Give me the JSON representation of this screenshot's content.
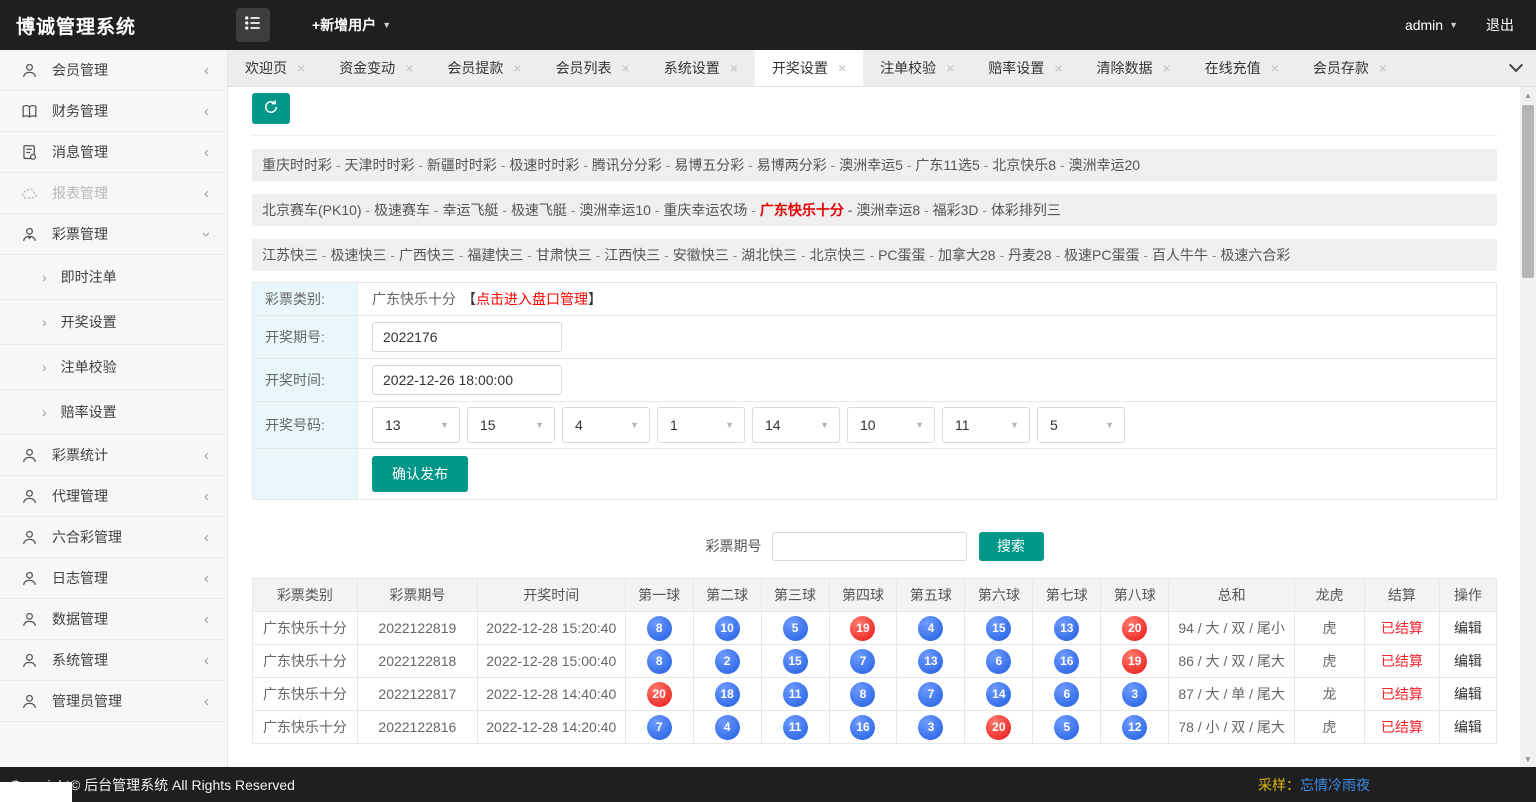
{
  "topbar": {
    "title": "博诚管理系统",
    "add_user": "+新增用户",
    "username": "admin",
    "logout": "退出"
  },
  "icons": {
    "close": "×",
    "caret_down": "▼",
    "chevron_left": "‹",
    "chevron_right": "›",
    "scroll_up": "▲",
    "scroll_down": "▼"
  },
  "tabs": [
    {
      "label": "欢迎页"
    },
    {
      "label": "资金变动"
    },
    {
      "label": "会员提款"
    },
    {
      "label": "会员列表"
    },
    {
      "label": "系统设置"
    },
    {
      "label": "开奖设置",
      "active": "true"
    },
    {
      "label": "注单校验"
    },
    {
      "label": "赔率设置"
    },
    {
      "label": "清除数据"
    },
    {
      "label": "在线充值"
    },
    {
      "label": "会员存款"
    }
  ],
  "sidebar": {
    "items": [
      {
        "label": "会员管理"
      },
      {
        "label": "财务管理"
      },
      {
        "label": "消息管理"
      },
      {
        "label": "报表管理"
      },
      {
        "label": "彩票管理",
        "expanded": "true",
        "children": [
          {
            "label": "即时注单"
          },
          {
            "label": "开奖设置"
          },
          {
            "label": "注单校验"
          },
          {
            "label": "赔率设置"
          }
        ]
      },
      {
        "label": "彩票统计"
      },
      {
        "label": "代理管理"
      },
      {
        "label": "六合彩管理"
      },
      {
        "label": "日志管理"
      },
      {
        "label": "数据管理"
      },
      {
        "label": "系统管理"
      },
      {
        "label": "管理员管理"
      }
    ]
  },
  "content": {
    "lottery_groups": [
      {
        "items": [
          {
            "label": "重庆时时彩"
          },
          {
            "label": "天津时时彩"
          },
          {
            "label": "新疆时时彩"
          },
          {
            "label": "极速时时彩"
          },
          {
            "label": "腾讯分分彩"
          },
          {
            "label": "易博五分彩"
          },
          {
            "label": "易博两分彩"
          },
          {
            "label": "澳洲幸运5"
          },
          {
            "label": "广东11选5"
          },
          {
            "label": "北京快乐8"
          },
          {
            "label": "澳洲幸运20"
          }
        ]
      },
      {
        "items": [
          {
            "label": "北京赛车(PK10)"
          },
          {
            "label": "极速赛车"
          },
          {
            "label": "幸运飞艇"
          },
          {
            "label": "极速飞艇"
          },
          {
            "label": "澳洲幸运10"
          },
          {
            "label": "重庆幸运农场"
          },
          {
            "label": "广东快乐十分",
            "active": "true"
          },
          {
            "label": "澳洲幸运8"
          },
          {
            "label": "福彩3D"
          },
          {
            "label": "体彩排列三"
          }
        ]
      },
      {
        "items": [
          {
            "label": "江苏快三"
          },
          {
            "label": "极速快三"
          },
          {
            "label": "广西快三"
          },
          {
            "label": "福建快三"
          },
          {
            "label": "甘肃快三"
          },
          {
            "label": "江西快三"
          },
          {
            "label": "安徽快三"
          },
          {
            "label": "湖北快三"
          },
          {
            "label": "北京快三"
          },
          {
            "label": "PC蛋蛋"
          },
          {
            "label": "加拿大28"
          },
          {
            "label": "丹麦28"
          },
          {
            "label": "极速PC蛋蛋"
          },
          {
            "label": "百人牛牛"
          },
          {
            "label": "极速六合彩"
          }
        ]
      }
    ],
    "form": {
      "category_label": "彩票类别:",
      "category_value": "广东快乐十分",
      "bracket_open": "【",
      "category_link": "点击进入盘口管理",
      "bracket_close": "】",
      "issue_label": "开奖期号:",
      "issue_value": "2022176",
      "time_label": "开奖时间:",
      "time_value": "2022-12-26 18:00:00",
      "numbers_label": "开奖号码:",
      "numbers": [
        "13",
        "15",
        "4",
        "1",
        "14",
        "10",
        "11",
        "5"
      ],
      "submit_label": "确认发布"
    },
    "search": {
      "label": "彩票期号",
      "value": "",
      "button": "搜索"
    },
    "table": {
      "headers": [
        "彩票类别",
        "彩票期号",
        "开奖时间",
        "第一球",
        "第二球",
        "第三球",
        "第四球",
        "第五球",
        "第六球",
        "第七球",
        "第八球",
        "总和",
        "龙虎",
        "结算",
        "操作"
      ],
      "rows": [
        {
          "type": "广东快乐十分",
          "issue": "2022122819",
          "time": "2022-12-28 15:20:40",
          "balls": [
            {
              "n": "8",
              "color": "blue"
            },
            {
              "n": "10",
              "color": "blue"
            },
            {
              "n": "5",
              "color": "blue"
            },
            {
              "n": "19",
              "color": "red"
            },
            {
              "n": "4",
              "color": "blue"
            },
            {
              "n": "15",
              "color": "blue"
            },
            {
              "n": "13",
              "color": "blue"
            },
            {
              "n": "20",
              "color": "red"
            }
          ],
          "sum": "94 / 大 / 双 / 尾小",
          "dragon_tiger": "虎",
          "status": "已结算",
          "action": "编辑"
        },
        {
          "type": "广东快乐十分",
          "issue": "2022122818",
          "time": "2022-12-28 15:00:40",
          "balls": [
            {
              "n": "8",
              "color": "blue"
            },
            {
              "n": "2",
              "color": "blue"
            },
            {
              "n": "15",
              "color": "blue"
            },
            {
              "n": "7",
              "color": "blue"
            },
            {
              "n": "13",
              "color": "blue"
            },
            {
              "n": "6",
              "color": "blue"
            },
            {
              "n": "16",
              "color": "blue"
            },
            {
              "n": "19",
              "color": "red"
            }
          ],
          "sum": "86 / 大 / 双 / 尾大",
          "dragon_tiger": "虎",
          "status": "已结算",
          "action": "编辑"
        },
        {
          "type": "广东快乐十分",
          "issue": "2022122817",
          "time": "2022-12-28 14:40:40",
          "balls": [
            {
              "n": "20",
              "color": "red"
            },
            {
              "n": "18",
              "color": "blue"
            },
            {
              "n": "11",
              "color": "blue"
            },
            {
              "n": "8",
              "color": "blue"
            },
            {
              "n": "7",
              "color": "blue"
            },
            {
              "n": "14",
              "color": "blue"
            },
            {
              "n": "6",
              "color": "blue"
            },
            {
              "n": "3",
              "color": "blue"
            }
          ],
          "sum": "87 / 大 / 单 / 尾大",
          "dragon_tiger": "龙",
          "status": "已结算",
          "action": "编辑"
        },
        {
          "type": "广东快乐十分",
          "issue": "2022122816",
          "time": "2022-12-28 14:20:40",
          "balls": [
            {
              "n": "7",
              "color": "blue"
            },
            {
              "n": "4",
              "color": "blue"
            },
            {
              "n": "11",
              "color": "blue"
            },
            {
              "n": "16",
              "color": "blue"
            },
            {
              "n": "3",
              "color": "blue"
            },
            {
              "n": "20",
              "color": "red"
            },
            {
              "n": "5",
              "color": "blue"
            },
            {
              "n": "12",
              "color": "blue"
            }
          ],
          "sum": "78 / 小 / 双 / 尾大",
          "dragon_tiger": "虎",
          "status": "已结算",
          "action": "编辑"
        }
      ]
    }
  },
  "footer": {
    "copyright": "Copyright© 后台管理系统 All Rights Reserved",
    "sample_label": "采样：",
    "sample_value": "忘情冷雨夜"
  }
}
